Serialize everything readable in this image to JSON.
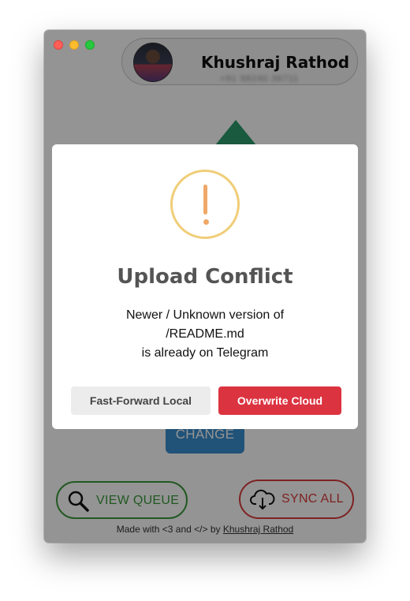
{
  "profile": {
    "name": "Khushraj Rathod",
    "phone": "+91 98240 36711"
  },
  "main": {
    "change_label": "CHANGE",
    "view_queue_label": "VIEW QUEUE",
    "sync_all_label": "SYNC ALL"
  },
  "footer": {
    "prefix": "Made with <3 and </> by ",
    "author": "Khushraj Rathod"
  },
  "dialog": {
    "title": "Upload Conflict",
    "line1": "Newer / Unknown version of",
    "line2": "/README.md",
    "line3": "is already on Telegram",
    "fast_forward_label": "Fast-Forward Local",
    "overwrite_label": "Overwrite Cloud"
  },
  "icons": {
    "warning": "warning-exclamation-icon",
    "search": "search-icon",
    "cloud_download": "cloud-download-icon",
    "upload_arrow": "upload-arrow-icon"
  },
  "colors": {
    "green": "#3a9a3a",
    "red": "#d93b3b",
    "blue": "#3a8ecf",
    "warning": "#f0cd78",
    "danger_button": "#dc3340"
  }
}
